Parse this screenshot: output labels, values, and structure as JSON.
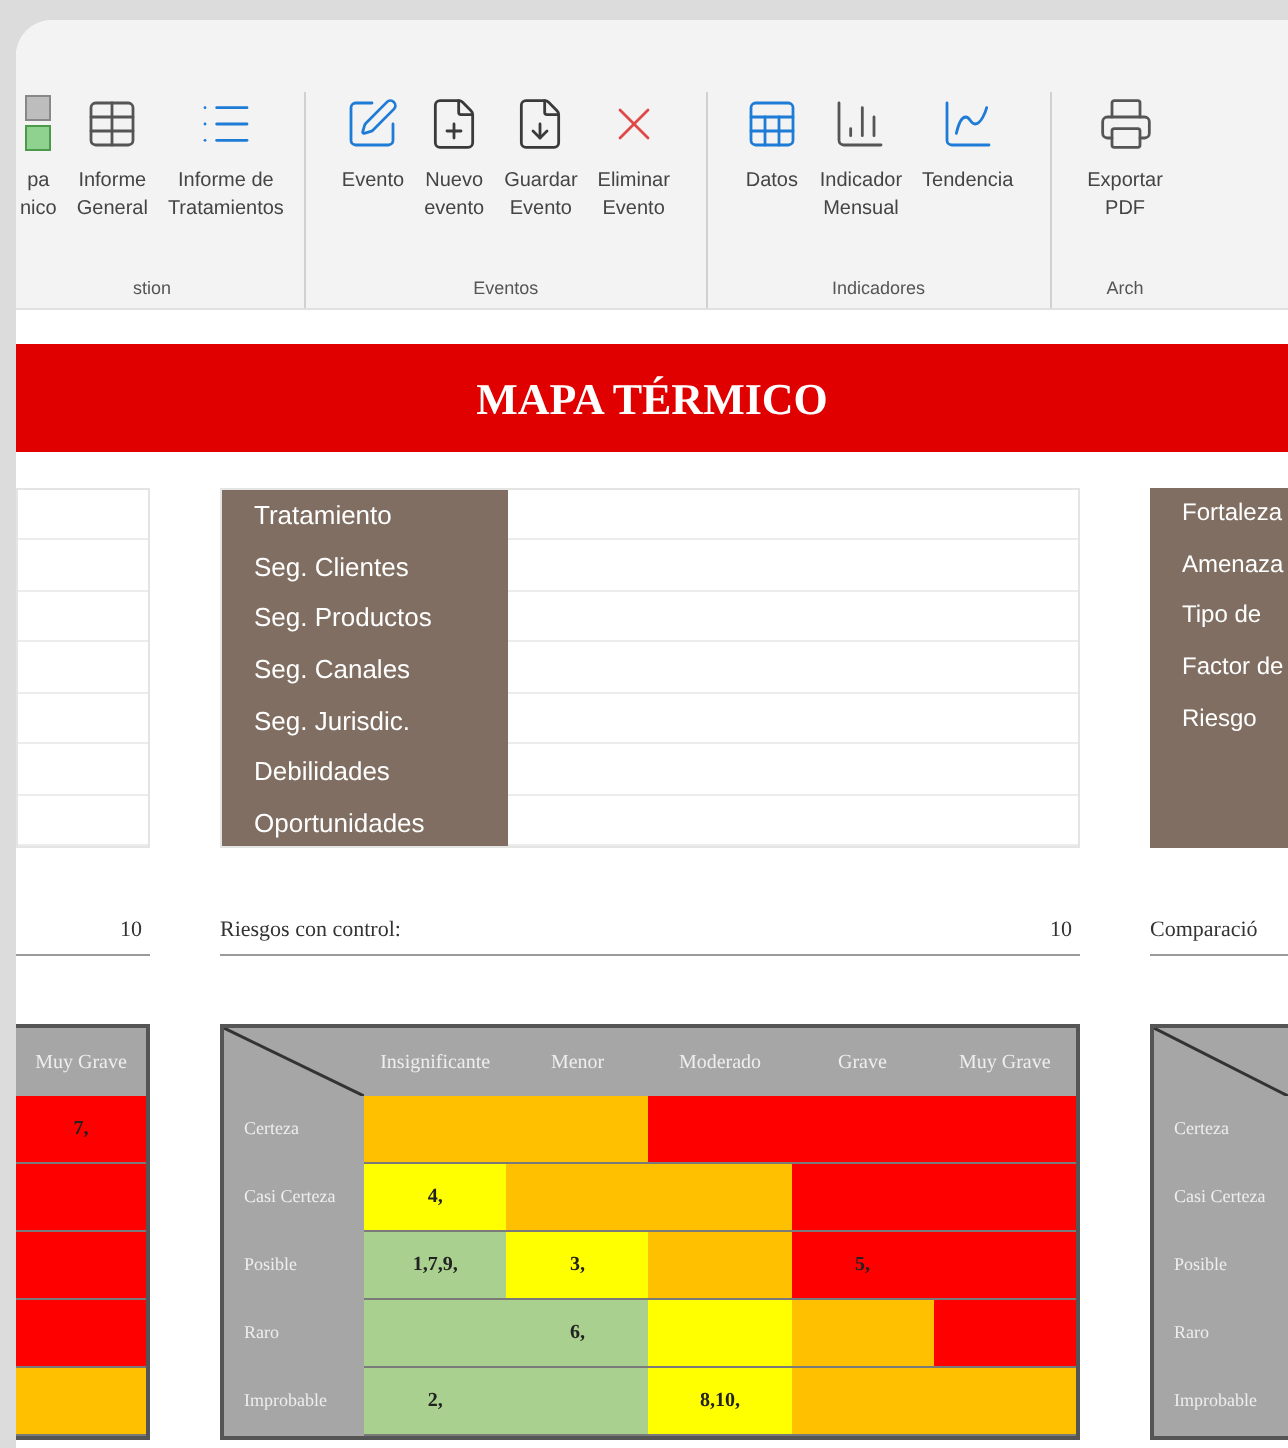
{
  "ribbon": {
    "groups": [
      {
        "label": "stion",
        "items": [
          {
            "kind": "map",
            "lines": [
              "pa",
              "nico"
            ]
          },
          {
            "kind": "table",
            "lines": [
              "Informe",
              "General"
            ]
          },
          {
            "kind": "list",
            "lines": [
              "Informe de",
              "Tratamientos"
            ]
          }
        ]
      },
      {
        "label": "Eventos",
        "items": [
          {
            "kind": "edit",
            "lines": [
              "Evento"
            ]
          },
          {
            "kind": "new",
            "lines": [
              "Nuevo",
              "evento"
            ]
          },
          {
            "kind": "save",
            "lines": [
              "Guardar",
              "Evento"
            ]
          },
          {
            "kind": "delete",
            "lines": [
              "Eliminar",
              "Evento"
            ]
          }
        ]
      },
      {
        "label": "Indicadores",
        "items": [
          {
            "kind": "data",
            "lines": [
              "Datos"
            ]
          },
          {
            "kind": "indicator",
            "lines": [
              "Indicador",
              "Mensual"
            ]
          },
          {
            "kind": "trend",
            "lines": [
              "Tendencia"
            ]
          }
        ]
      },
      {
        "label": "Arch",
        "items": [
          {
            "kind": "export",
            "lines": [
              "Exportar",
              "PDF"
            ]
          }
        ]
      }
    ]
  },
  "banner": {
    "title": "MAPA TÉRMICO"
  },
  "panels": [
    {
      "kind": "fields"
    },
    {
      "kind": "labeled",
      "labels": [
        "Tratamiento",
        "Seg. Clientes",
        "Seg. Productos",
        "Seg. Canales",
        "Seg. Jurisdic.",
        "Debilidades",
        "Oportunidades"
      ]
    },
    {
      "kind": "labels_only",
      "labels": [
        "Fortaleza",
        "Amenaza",
        "Tipo de",
        "Factor de",
        "Riesgo"
      ]
    }
  ],
  "sections": [
    {
      "count": "10"
    },
    {
      "title": "Riesgos con control:",
      "count": "10"
    },
    {
      "title": "Comparació"
    }
  ],
  "heatmaps": [
    {
      "kind": "partial",
      "columns": [
        "Muy Grave"
      ],
      "rows": [
        {
          "cells": [
            {
              "color": "#ff0000",
              "text": "7,"
            }
          ]
        },
        {
          "cells": [
            {
              "color": "#ff0000"
            }
          ]
        },
        {
          "cells": [
            {
              "color": "#ff0000"
            }
          ]
        },
        {
          "cells": [
            {
              "color": "#ff0000"
            }
          ]
        },
        {
          "cells": [
            {
              "color": "#ffc000"
            }
          ]
        }
      ]
    },
    {
      "kind": "full",
      "columns": [
        "Insignificante",
        "Menor",
        "Moderado",
        "Grave",
        "Muy Grave"
      ],
      "rows": [
        {
          "label": "Certeza",
          "cells": [
            {
              "color": "#ffc000"
            },
            {
              "color": "#ffc000"
            },
            {
              "color": "#ff0000"
            },
            {
              "color": "#ff0000"
            },
            {
              "color": "#ff0000"
            }
          ]
        },
        {
          "label": "Casi Certeza",
          "cells": [
            {
              "color": "#ffff00",
              "text": "4,"
            },
            {
              "color": "#ffc000"
            },
            {
              "color": "#ffc000"
            },
            {
              "color": "#ff0000"
            },
            {
              "color": "#ff0000"
            }
          ]
        },
        {
          "label": "Posible",
          "cells": [
            {
              "color": "#a9d08e",
              "text": "1,7,9,"
            },
            {
              "color": "#ffff00",
              "text": "3,"
            },
            {
              "color": "#ffc000"
            },
            {
              "color": "#ff0000",
              "text": "5,"
            },
            {
              "color": "#ff0000"
            }
          ]
        },
        {
          "label": "Raro",
          "cells": [
            {
              "color": "#a9d08e"
            },
            {
              "color": "#a9d08e",
              "text": "6,"
            },
            {
              "color": "#ffff00"
            },
            {
              "color": "#ffc000"
            },
            {
              "color": "#ff0000"
            }
          ]
        },
        {
          "label": "Improbable",
          "cells": [
            {
              "color": "#a9d08e",
              "text": "2,"
            },
            {
              "color": "#a9d08e"
            },
            {
              "color": "#ffff00",
              "text": "8,10,"
            },
            {
              "color": "#ffc000"
            },
            {
              "color": "#ffc000"
            }
          ]
        }
      ]
    },
    {
      "kind": "labels",
      "rows": [
        {
          "label": "Certeza"
        },
        {
          "label": "Casi Certeza"
        },
        {
          "label": "Posible"
        },
        {
          "label": "Raro"
        },
        {
          "label": "Improbable"
        }
      ]
    }
  ]
}
